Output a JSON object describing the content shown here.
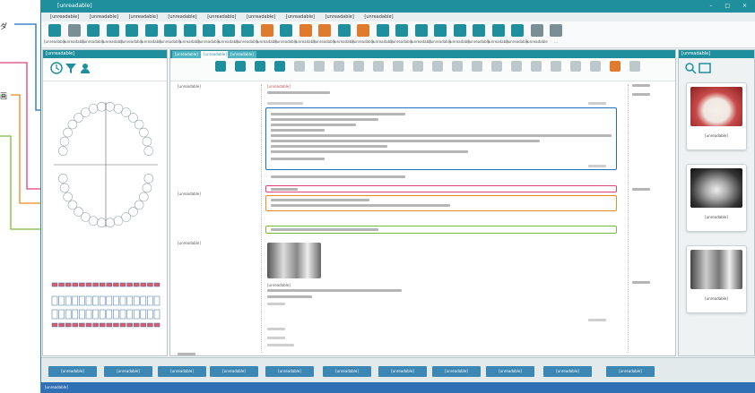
{
  "callouts": [
    {
      "text": "ダ",
      "color": "#1e6fbf"
    },
    {
      "text": "",
      "color": "#e0407a"
    },
    {
      "text": "画",
      "color": "#ef8a1c"
    },
    {
      "text": "",
      "color": "#7cb83a"
    }
  ],
  "window": {
    "title": "[unreadable]",
    "controls": "– □ ×"
  },
  "menu": [
    "[unreadable]",
    "[unreadable]",
    "[unreadable]",
    "[unreadable]",
    "[unreadable]",
    "[unreadable]",
    "[unreadable]",
    "[unreadable]",
    "[unreadable]"
  ],
  "toolbar": {
    "icons": [
      {
        "name": "patient-icon",
        "color": "#1f8f9e",
        "label": "[unreadable]"
      },
      {
        "name": "register-icon",
        "color": "#7a8e96",
        "label": "[unreadable]"
      },
      {
        "name": "reception-icon",
        "color": "#1f8f9e",
        "label": "[unreadable]"
      },
      {
        "name": "clock-icon",
        "color": "#1f8f9e",
        "label": "[unreadable]"
      },
      {
        "name": "gear-icon",
        "color": "#1f8f9e",
        "label": "[unreadable]"
      },
      {
        "name": "accounting-icon",
        "color": "#1f8f9e",
        "label": "[unreadable]"
      },
      {
        "name": "calendar-icon",
        "color": "#1f8f9e",
        "label": "[unreadable]"
      },
      {
        "name": "user-icon",
        "color": "#1f8f9e",
        "label": "[unreadable]"
      },
      {
        "name": "monitor-icon",
        "color": "#1f8f9e",
        "label": "[unreadable]"
      },
      {
        "name": "chat-icon",
        "color": "#1f8f9e",
        "label": "[unreadable]"
      },
      {
        "name": "doctor-icon",
        "color": "#1f8f9e",
        "label": "[unreadable]"
      },
      {
        "name": "chart-icon",
        "color": "#e07a2c",
        "label": "[unreadable]"
      },
      {
        "name": "group-icon",
        "color": "#1f8f9e",
        "label": "[unreadable]"
      },
      {
        "name": "document-icon",
        "color": "#e07a2c",
        "label": "[unreadable]"
      },
      {
        "name": "print-icon",
        "color": "#e07a2c",
        "label": "[unreadable]"
      },
      {
        "name": "list-icon",
        "color": "#1f8f9e",
        "label": "[unreadable]"
      },
      {
        "name": "report-icon",
        "color": "#e07a2c",
        "label": "[unreadable]"
      },
      {
        "name": "clipboard-icon",
        "color": "#1f8f9e",
        "label": "[unreadable]"
      },
      {
        "name": "bookmark-icon",
        "color": "#1f8f9e",
        "label": "[unreadable]"
      },
      {
        "name": "question-icon",
        "color": "#1f8f9e",
        "label": "[unreadable]"
      },
      {
        "name": "stats-icon",
        "color": "#1f8f9e",
        "label": "[unreadable]"
      },
      {
        "name": "ledger-icon",
        "color": "#1f8f9e",
        "label": "[unreadable]"
      },
      {
        "name": "monitor2-icon",
        "color": "#1f8f9e",
        "label": "[unreadable]"
      },
      {
        "name": "receipt-icon",
        "color": "#1f8f9e",
        "label": "[unreadable]"
      },
      {
        "name": "folder-icon",
        "color": "#1f8f9e",
        "label": "[unreadable]"
      },
      {
        "name": "radiation-icon",
        "color": "#7a8e96",
        "label": "[unreadable]"
      },
      {
        "name": "more-icon",
        "color": "#7a8e96",
        "label": "..."
      }
    ]
  },
  "left_panel": {
    "header": "[unreadable]"
  },
  "mid_panel": {
    "tabs": [
      "[unreadable]",
      "[unreadable]",
      "[unreadable]"
    ],
    "left_labels": [
      "[unreadable]",
      "[unreadable]",
      "[unreadable]"
    ],
    "section_title": "[unreadable]",
    "xray_caption": "[unreadable]"
  },
  "right_panel": {
    "header": "[unreadable]",
    "thumbs": [
      {
        "caption": "[unreadable]",
        "kind": "photo"
      },
      {
        "caption": "[unreadable]",
        "kind": "panoramic"
      },
      {
        "caption": "[unreadable]",
        "kind": "xray"
      }
    ]
  },
  "bottom_buttons": [
    "[unreadable]",
    "[unreadable]",
    "[unreadable]",
    "[unreadable]",
    "[unreadable]",
    "[unreadable]",
    "[unreadable]",
    "[unreadable]",
    "[unreadable]",
    "[unreadable]",
    "[unreadable]"
  ],
  "status": "[unreadable]"
}
